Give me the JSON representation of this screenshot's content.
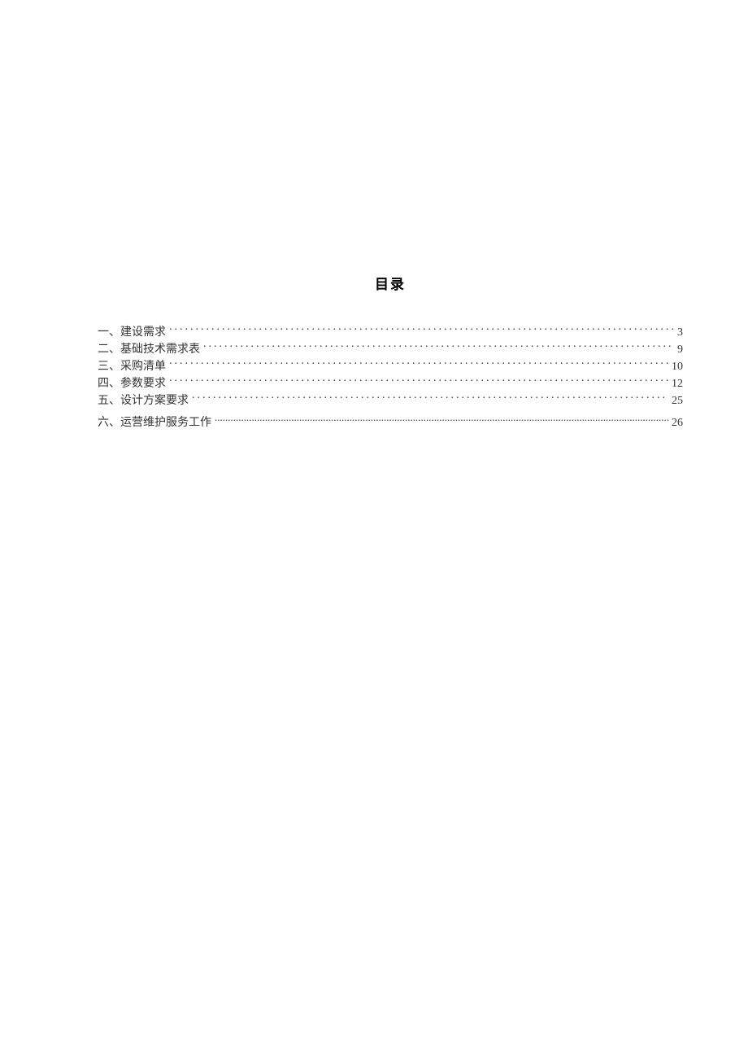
{
  "toc": {
    "title": "目录",
    "entries": [
      {
        "label": "一、建设需求",
        "page": "3"
      },
      {
        "label": "二、基础技术需求表",
        "page": "9"
      },
      {
        "label": "三、采购清单",
        "page": "10"
      },
      {
        "label": "四、参数要求",
        "page": "12"
      },
      {
        "label": "五、设计方案要求",
        "page": "25"
      },
      {
        "label": "六、运营维护服务工作",
        "page": "26"
      }
    ]
  }
}
